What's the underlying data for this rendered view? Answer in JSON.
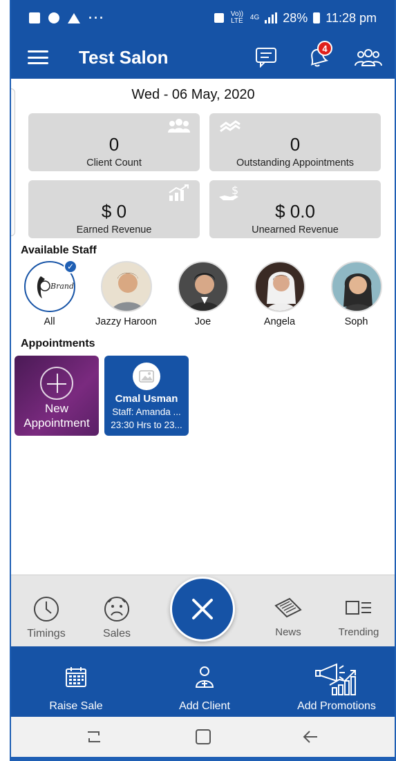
{
  "status_bar": {
    "network_label": "Vo)) LTE",
    "network_type": "4G",
    "battery": "28%",
    "time": "11:28 pm",
    "dots": "···"
  },
  "app_bar": {
    "title": "Test Salon",
    "notification_count": "4"
  },
  "date": "Wed - 06 May, 2020",
  "stats": [
    {
      "value": "0",
      "label": "Client Count",
      "icon": "group-icon"
    },
    {
      "value": "0",
      "label": "Outstanding Appointments",
      "icon": "hands-icon"
    },
    {
      "value": "$ 0",
      "label": "Earned Revenue",
      "icon": "growth-chart-icon"
    },
    {
      "value": "$ 0.0",
      "label": "Unearned Revenue",
      "icon": "dollar-hand-icon"
    }
  ],
  "staff_section": {
    "title": "Available Staff",
    "items": [
      {
        "name": "All",
        "selected": true
      },
      {
        "name": "Jazzy Haroon"
      },
      {
        "name": "Joe"
      },
      {
        "name": "Angela"
      },
      {
        "name": "Soph"
      }
    ]
  },
  "appointments_section": {
    "title": "Appointments",
    "new_label_line1": "New",
    "new_label_line2": "Appointment",
    "cards": [
      {
        "client": "Cmal Usman",
        "staff": "Staff: Amanda ...",
        "time": "23:30 Hrs to 23..."
      }
    ]
  },
  "bottom_menu": {
    "timings": "Timings",
    "sales": "Sales",
    "news": "News",
    "trending": "Trending"
  },
  "action_bar": {
    "raise_sale": "Raise Sale",
    "add_client": "Add Client",
    "add_promotions": "Add Promotions"
  },
  "colors": {
    "primary": "#1653a6",
    "card_bg": "#d9d9d9",
    "badge": "#e0201b",
    "new_appointment": "#6a2470"
  }
}
